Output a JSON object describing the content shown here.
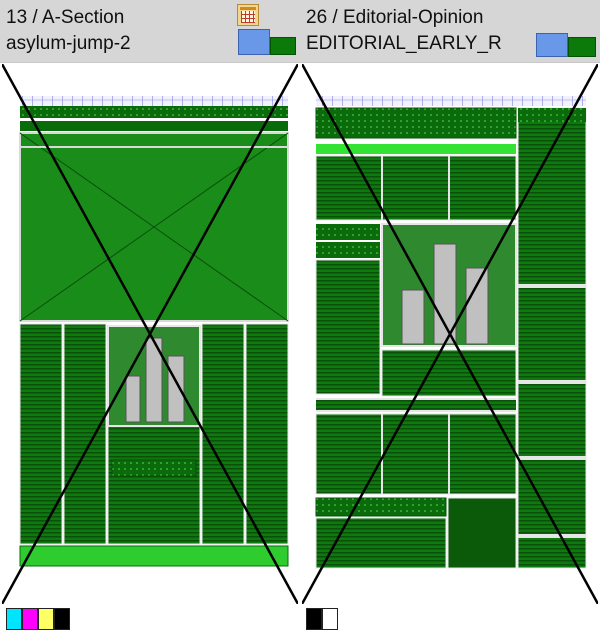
{
  "panels": [
    {
      "page_label": "13 / A-Section",
      "slug": "asylum-jump-2",
      "swatches": [
        "#00e5ff",
        "#ff00ff",
        "#ffff66",
        "#000000"
      ]
    },
    {
      "page_label": "26 / Editorial-Opinion",
      "slug": "EDITORIAL_EARLY_R",
      "swatches": [
        "#000000",
        "#ffffff"
      ]
    }
  ],
  "colors": {
    "dark_green": "#0a6b0a",
    "mid_green": "#1f9a1f",
    "light_green": "#3ad13a",
    "photo_fill": "#2f8a2f",
    "bars_fill": "#c0c0c0",
    "header_bg": "#d6d6d6",
    "mini_blue": "#6a98e8"
  },
  "icons": [
    "calendar-icon",
    "layout-thumbnail-icon"
  ]
}
